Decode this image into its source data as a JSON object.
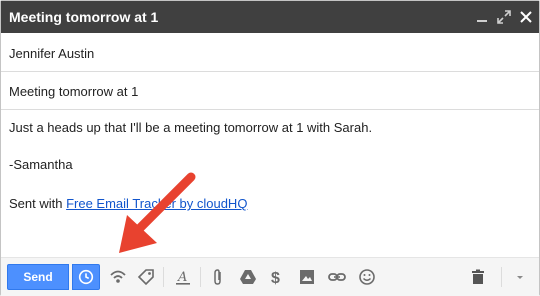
{
  "window": {
    "title": "Meeting tomorrow at 1",
    "controls": [
      "minimize-icon",
      "popout-icon",
      "close-icon"
    ]
  },
  "compose": {
    "to": "Jennifer Austin",
    "subject": "Meeting tomorrow at 1",
    "body": {
      "line1": "Just a heads up that I'll be a meeting tomorrow at 1 with Sarah.",
      "signature": "-Samantha",
      "sent_with_prefix": "Sent with ",
      "sent_with_link": "Free Email Tracker by cloudHQ"
    }
  },
  "toolbar": {
    "send_label": "Send",
    "icons": [
      "schedule-send-icon",
      "tracking-icon",
      "tag-icon",
      "formatting-icon",
      "attach-icon",
      "drive-icon",
      "money-icon",
      "photo-icon",
      "link-icon",
      "emoji-icon",
      "trash-icon",
      "more-options-icon"
    ]
  },
  "colors": {
    "titlebar": "#404040",
    "send": "#4d90fe",
    "link": "#1155cc",
    "arrow": "#e8422f"
  }
}
